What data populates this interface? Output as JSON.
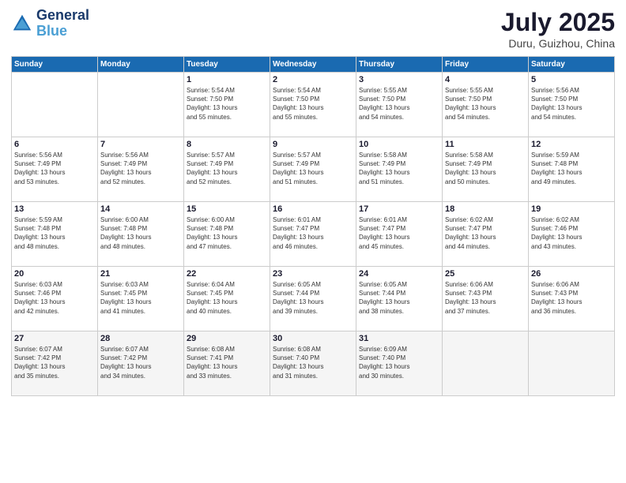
{
  "header": {
    "logo_line1": "General",
    "logo_line2": "Blue",
    "month_year": "July 2025",
    "location": "Duru, Guizhou, China"
  },
  "days_of_week": [
    "Sunday",
    "Monday",
    "Tuesday",
    "Wednesday",
    "Thursday",
    "Friday",
    "Saturday"
  ],
  "weeks": [
    [
      {
        "day": "",
        "detail": ""
      },
      {
        "day": "",
        "detail": ""
      },
      {
        "day": "1",
        "detail": "Sunrise: 5:54 AM\nSunset: 7:50 PM\nDaylight: 13 hours\nand 55 minutes."
      },
      {
        "day": "2",
        "detail": "Sunrise: 5:54 AM\nSunset: 7:50 PM\nDaylight: 13 hours\nand 55 minutes."
      },
      {
        "day": "3",
        "detail": "Sunrise: 5:55 AM\nSunset: 7:50 PM\nDaylight: 13 hours\nand 54 minutes."
      },
      {
        "day": "4",
        "detail": "Sunrise: 5:55 AM\nSunset: 7:50 PM\nDaylight: 13 hours\nand 54 minutes."
      },
      {
        "day": "5",
        "detail": "Sunrise: 5:56 AM\nSunset: 7:50 PM\nDaylight: 13 hours\nand 54 minutes."
      }
    ],
    [
      {
        "day": "6",
        "detail": "Sunrise: 5:56 AM\nSunset: 7:49 PM\nDaylight: 13 hours\nand 53 minutes."
      },
      {
        "day": "7",
        "detail": "Sunrise: 5:56 AM\nSunset: 7:49 PM\nDaylight: 13 hours\nand 52 minutes."
      },
      {
        "day": "8",
        "detail": "Sunrise: 5:57 AM\nSunset: 7:49 PM\nDaylight: 13 hours\nand 52 minutes."
      },
      {
        "day": "9",
        "detail": "Sunrise: 5:57 AM\nSunset: 7:49 PM\nDaylight: 13 hours\nand 51 minutes."
      },
      {
        "day": "10",
        "detail": "Sunrise: 5:58 AM\nSunset: 7:49 PM\nDaylight: 13 hours\nand 51 minutes."
      },
      {
        "day": "11",
        "detail": "Sunrise: 5:58 AM\nSunset: 7:49 PM\nDaylight: 13 hours\nand 50 minutes."
      },
      {
        "day": "12",
        "detail": "Sunrise: 5:59 AM\nSunset: 7:48 PM\nDaylight: 13 hours\nand 49 minutes."
      }
    ],
    [
      {
        "day": "13",
        "detail": "Sunrise: 5:59 AM\nSunset: 7:48 PM\nDaylight: 13 hours\nand 48 minutes."
      },
      {
        "day": "14",
        "detail": "Sunrise: 6:00 AM\nSunset: 7:48 PM\nDaylight: 13 hours\nand 48 minutes."
      },
      {
        "day": "15",
        "detail": "Sunrise: 6:00 AM\nSunset: 7:48 PM\nDaylight: 13 hours\nand 47 minutes."
      },
      {
        "day": "16",
        "detail": "Sunrise: 6:01 AM\nSunset: 7:47 PM\nDaylight: 13 hours\nand 46 minutes."
      },
      {
        "day": "17",
        "detail": "Sunrise: 6:01 AM\nSunset: 7:47 PM\nDaylight: 13 hours\nand 45 minutes."
      },
      {
        "day": "18",
        "detail": "Sunrise: 6:02 AM\nSunset: 7:47 PM\nDaylight: 13 hours\nand 44 minutes."
      },
      {
        "day": "19",
        "detail": "Sunrise: 6:02 AM\nSunset: 7:46 PM\nDaylight: 13 hours\nand 43 minutes."
      }
    ],
    [
      {
        "day": "20",
        "detail": "Sunrise: 6:03 AM\nSunset: 7:46 PM\nDaylight: 13 hours\nand 42 minutes."
      },
      {
        "day": "21",
        "detail": "Sunrise: 6:03 AM\nSunset: 7:45 PM\nDaylight: 13 hours\nand 41 minutes."
      },
      {
        "day": "22",
        "detail": "Sunrise: 6:04 AM\nSunset: 7:45 PM\nDaylight: 13 hours\nand 40 minutes."
      },
      {
        "day": "23",
        "detail": "Sunrise: 6:05 AM\nSunset: 7:44 PM\nDaylight: 13 hours\nand 39 minutes."
      },
      {
        "day": "24",
        "detail": "Sunrise: 6:05 AM\nSunset: 7:44 PM\nDaylight: 13 hours\nand 38 minutes."
      },
      {
        "day": "25",
        "detail": "Sunrise: 6:06 AM\nSunset: 7:43 PM\nDaylight: 13 hours\nand 37 minutes."
      },
      {
        "day": "26",
        "detail": "Sunrise: 6:06 AM\nSunset: 7:43 PM\nDaylight: 13 hours\nand 36 minutes."
      }
    ],
    [
      {
        "day": "27",
        "detail": "Sunrise: 6:07 AM\nSunset: 7:42 PM\nDaylight: 13 hours\nand 35 minutes."
      },
      {
        "day": "28",
        "detail": "Sunrise: 6:07 AM\nSunset: 7:42 PM\nDaylight: 13 hours\nand 34 minutes."
      },
      {
        "day": "29",
        "detail": "Sunrise: 6:08 AM\nSunset: 7:41 PM\nDaylight: 13 hours\nand 33 minutes."
      },
      {
        "day": "30",
        "detail": "Sunrise: 6:08 AM\nSunset: 7:40 PM\nDaylight: 13 hours\nand 31 minutes."
      },
      {
        "day": "31",
        "detail": "Sunrise: 6:09 AM\nSunset: 7:40 PM\nDaylight: 13 hours\nand 30 minutes."
      },
      {
        "day": "",
        "detail": ""
      },
      {
        "day": "",
        "detail": ""
      }
    ]
  ]
}
